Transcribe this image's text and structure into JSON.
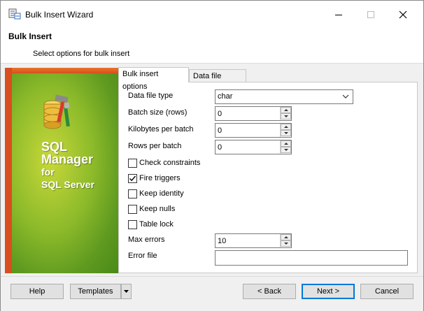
{
  "window": {
    "title": "Bulk Insert Wizard"
  },
  "header": {
    "title": "Bulk Insert",
    "subtitle": "Select options for bulk insert"
  },
  "banner": {
    "line1": "SQL",
    "line2": "Manager",
    "line3": "for",
    "line4": "SQL Server"
  },
  "tabs": [
    {
      "label": "Bulk insert options",
      "active": true
    },
    {
      "label": "Data file format",
      "active": false
    }
  ],
  "form": {
    "data_file_type": {
      "label": "Data file type",
      "value": "char"
    },
    "batch_size": {
      "label": "Batch size (rows)",
      "value": "0"
    },
    "kilobytes_per_batch": {
      "label": "Kilobytes per batch",
      "value": "0"
    },
    "rows_per_batch": {
      "label": "Rows per batch",
      "value": "0"
    },
    "check_constraints": {
      "label": "Check constraints",
      "checked": false
    },
    "fire_triggers": {
      "label": "Fire triggers",
      "checked": true
    },
    "keep_identity": {
      "label": "Keep identity",
      "checked": false
    },
    "keep_nulls": {
      "label": "Keep nulls",
      "checked": false
    },
    "table_lock": {
      "label": "Table lock",
      "checked": false
    },
    "max_errors": {
      "label": "Max errors",
      "value": "10"
    },
    "error_file": {
      "label": "Error file",
      "value": ""
    }
  },
  "footer": {
    "help": "Help",
    "templates": "Templates",
    "back": "< Back",
    "next": "Next >",
    "cancel": "Cancel"
  }
}
